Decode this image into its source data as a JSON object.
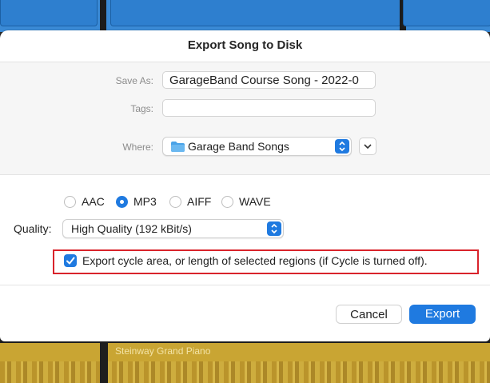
{
  "dialog": {
    "title": "Export Song to Disk",
    "save_as_label": "Save As:",
    "save_as_value": "GarageBand Course Song - 2022-0",
    "tags_label": "Tags:",
    "tags_value": "",
    "where_label": "Where:",
    "where_value": "Garage Band Songs",
    "formats": [
      {
        "label": "AAC",
        "selected": false
      },
      {
        "label": "MP3",
        "selected": true
      },
      {
        "label": "AIFF",
        "selected": false
      },
      {
        "label": "WAVE",
        "selected": false
      }
    ],
    "quality_label": "Quality:",
    "quality_value": "High Quality (192 kBit/s)",
    "cycle_checkbox_label": "Export cycle area, or length of selected regions (if Cycle is turned off).",
    "cycle_checked": true,
    "cancel_label": "Cancel",
    "export_label": "Export"
  },
  "background": {
    "track_label": "Steinway Grand Piano"
  },
  "colors": {
    "accent": "#1f7ae0",
    "highlight": "#d9232b",
    "track_blue": "#3a8ad6",
    "track_yellow": "#c9a533"
  },
  "icons": [
    "folder-icon",
    "chevron-up-down-icon",
    "chevron-down-icon",
    "checkmark-icon"
  ]
}
